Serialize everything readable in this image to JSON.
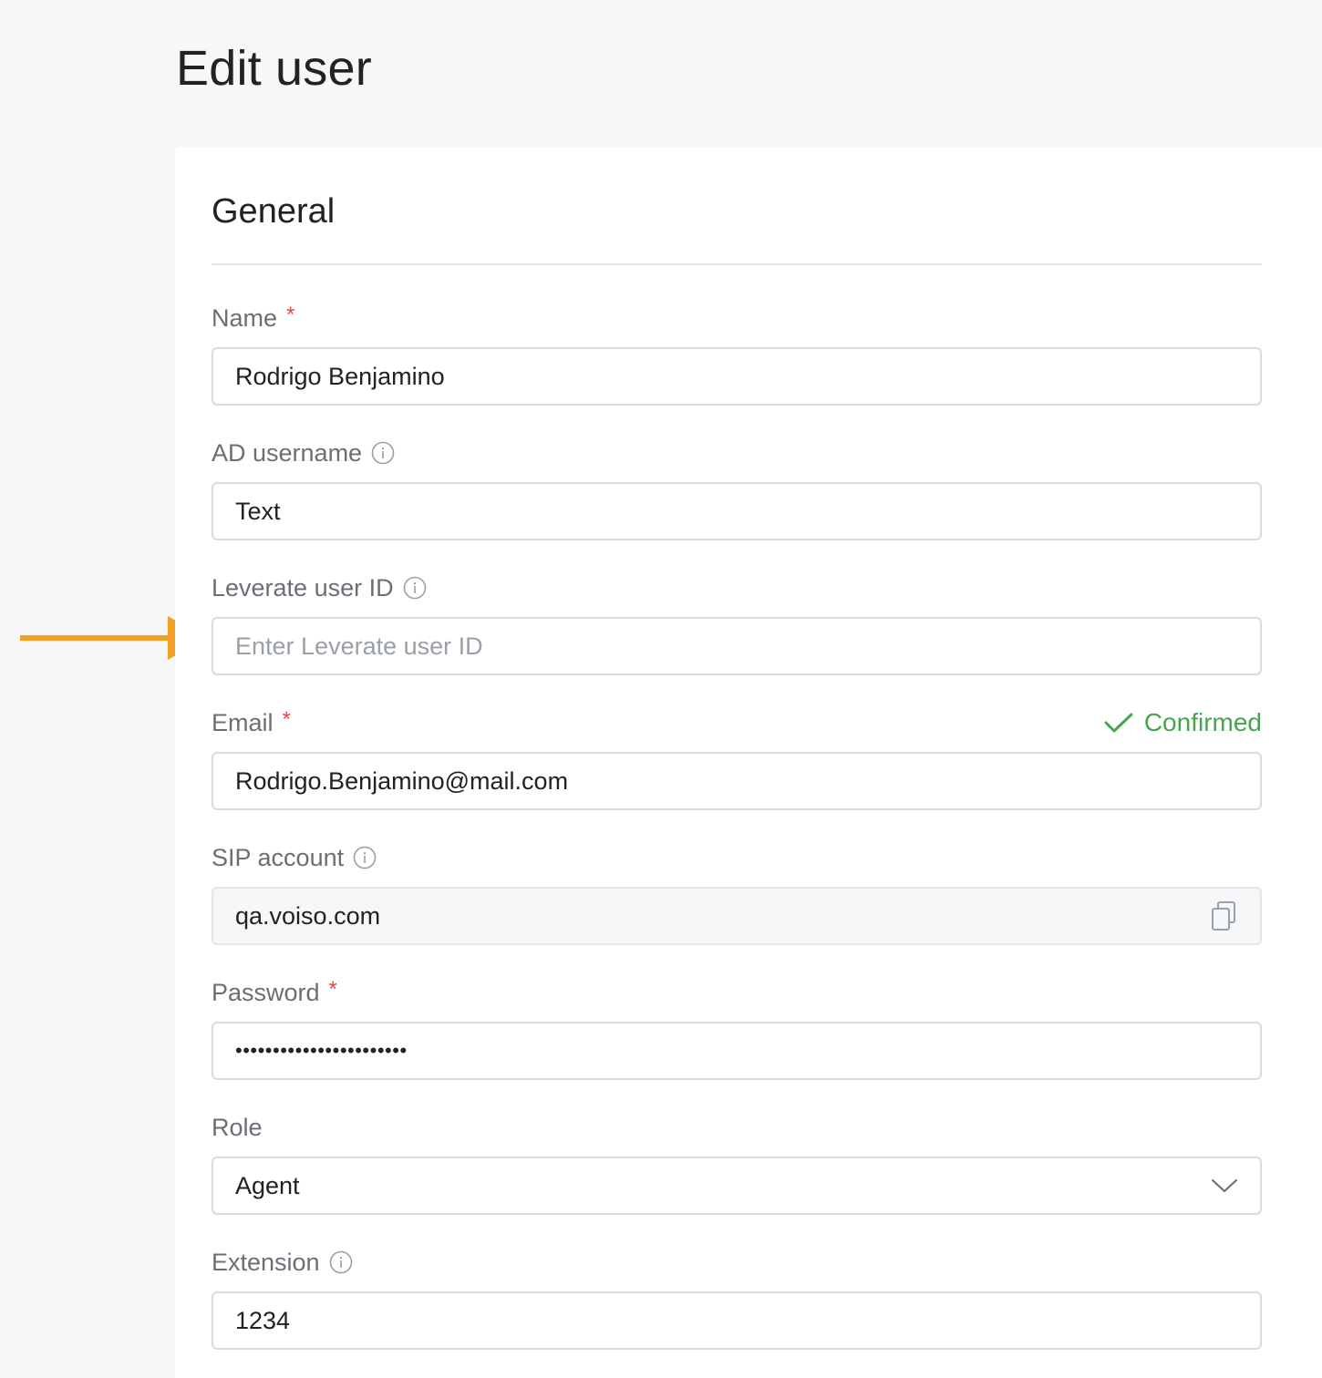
{
  "page": {
    "title": "Edit user"
  },
  "section": {
    "title": "General"
  },
  "fields": {
    "name": {
      "label": "Name",
      "required_mark": "*",
      "value": "Rodrigo Benjamino"
    },
    "ad_username": {
      "label": "AD username",
      "value": "Text"
    },
    "leverate_id": {
      "label": "Leverate user ID",
      "placeholder": "Enter Leverate user ID"
    },
    "email": {
      "label": "Email",
      "required_mark": "*",
      "value": "Rodrigo.Benjamino@mail.com",
      "status": "Confirmed"
    },
    "sip_account": {
      "label": "SIP account",
      "value": "qa.voiso.com"
    },
    "password": {
      "label": "Password",
      "required_mark": "*",
      "value": "•••••••••••••••••••••••"
    },
    "role": {
      "label": "Role",
      "value": "Agent"
    },
    "extension": {
      "label": "Extension",
      "value": "1234"
    }
  },
  "icons": {
    "info": "info-icon",
    "check": "check-icon",
    "copy": "copy-icon",
    "chevron": "chevron-down-icon",
    "arrow": "arrow-right-icon"
  },
  "colors": {
    "required": "#e24a4a",
    "confirmed": "#4aa34f",
    "annotation_arrow": "#f5a024"
  }
}
